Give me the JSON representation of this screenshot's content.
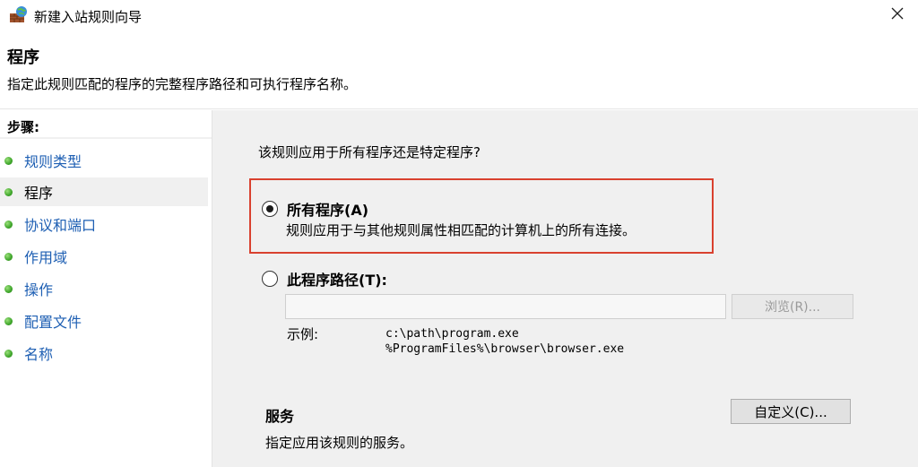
{
  "window": {
    "title": "新建入站规则向导",
    "icon": "firewall-icon",
    "close_icon": "close-icon"
  },
  "header": {
    "title": "程序",
    "description": "指定此规则匹配的程序的完整程序路径和可执行程序名称。"
  },
  "sidebar": {
    "steps_label": "步骤:",
    "items": [
      {
        "label": "规则类型",
        "active": false
      },
      {
        "label": "程序",
        "active": true
      },
      {
        "label": "协议和端口",
        "active": false
      },
      {
        "label": "作用域",
        "active": false
      },
      {
        "label": "操作",
        "active": false
      },
      {
        "label": "配置文件",
        "active": false
      },
      {
        "label": "名称",
        "active": false
      }
    ]
  },
  "main": {
    "question": "该规则应用于所有程序还是特定程序?",
    "option_all": {
      "label": "所有程序(A)",
      "description": "规则应用于与其他规则属性相匹配的计算机上的所有连接。",
      "selected": true
    },
    "option_path": {
      "label": "此程序路径(T):",
      "selected": false
    },
    "path_input": {
      "value": "",
      "placeholder": ""
    },
    "browse_label": "浏览(R)...",
    "example_label": "示例:",
    "example_lines": "c:\\path\\program.exe\n%ProgramFiles%\\browser\\browser.exe",
    "services_title": "服务",
    "services_desc": "指定应用该规则的服务。",
    "customize_label": "自定义(C)..."
  },
  "colors": {
    "link": "#1e5fb3",
    "highlight_border": "#d9412f",
    "bullet": "#3ea52a",
    "panel_bg": "#f0f0f0"
  }
}
